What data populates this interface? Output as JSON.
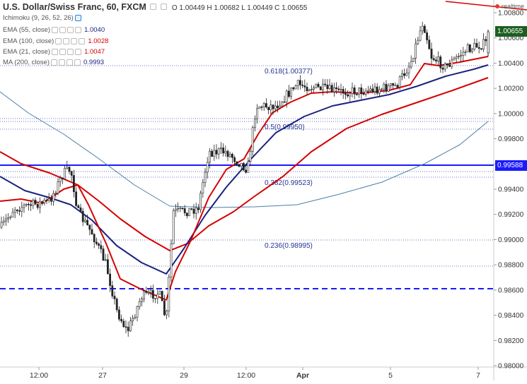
{
  "header": {
    "title": "U.S. Dollar/Swiss Franc, 60, FXCM",
    "ohlc": "O 1.00449 H 1.00682 L 1.00449 C 1.00655"
  },
  "indicators": [
    {
      "label": "Ichimoku (9, 26, 52, 26)",
      "value": "",
      "color": "#555555"
    },
    {
      "label": "EMA (55, close)",
      "value": "1.0040",
      "color": "#1a237e"
    },
    {
      "label": "EMA (100, close)",
      "value": "1.0028",
      "color": "#d50000"
    },
    {
      "label": "EMA (21, close)",
      "value": "1.0047",
      "color": "#d50000"
    },
    {
      "label": "MA (200, close)",
      "value": "0.9993",
      "color": "#1a237e"
    }
  ],
  "realtime_label": "realtime",
  "price_axis": {
    "ticks": [
      "1.00800",
      "1.00600",
      "1.00400",
      "1.00200",
      "1.00000",
      "0.99800",
      "0.99600",
      "0.99400",
      "0.99200",
      "0.99000",
      "0.98800",
      "0.98600",
      "0.98400",
      "0.98200",
      "0.98000"
    ],
    "current_price": "1.00655",
    "line_price": "0.99588",
    "current_color": "#1b5e20",
    "line_color": "#1a1aff"
  },
  "time_axis": {
    "ticks": [
      "12:00",
      "27",
      "29",
      "12:00",
      "Apr",
      "5",
      "7"
    ]
  },
  "fibonacci": {
    "levels": [
      "0.618(1.00377)",
      "0.5(0.99950)",
      "0.382(0.99523)",
      "0.236(0.98995)"
    ]
  },
  "colors": {
    "ema21": "#d50000",
    "ema55": "#1a237e",
    "ema100": "#d50000",
    "ma200": "#4a7fa8",
    "candle": "#222222",
    "solid_line": "#1a1aff",
    "dashed_line": "#1a1aff"
  }
}
